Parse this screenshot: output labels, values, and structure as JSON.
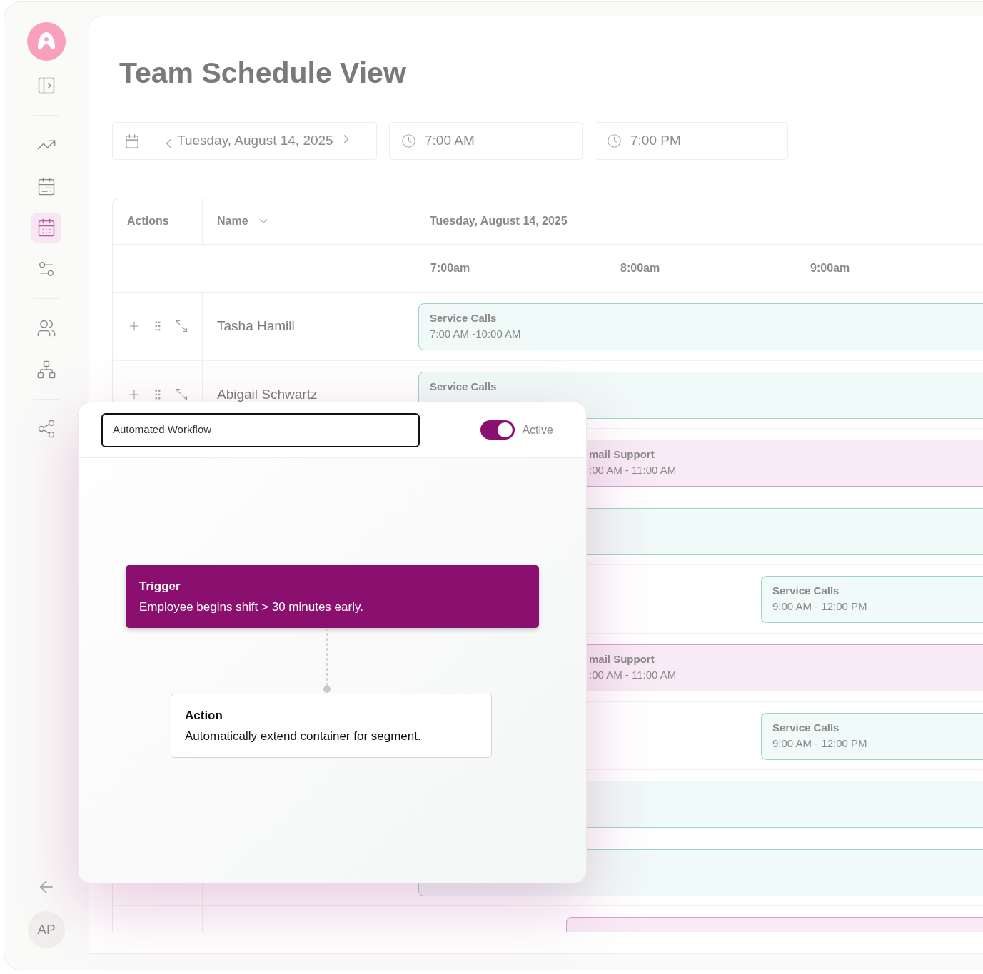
{
  "sidebar": {
    "groups": [
      [
        {
          "kind": "trend",
          "selected": false
        },
        {
          "kind": "calendarlist",
          "selected": false
        },
        {
          "kind": "calendargrid",
          "selected": true
        },
        {
          "kind": "sliders",
          "selected": false
        }
      ],
      [
        {
          "kind": "users",
          "selected": false
        },
        {
          "kind": "network",
          "selected": false
        }
      ],
      [
        {
          "kind": "share",
          "selected": false
        }
      ]
    ],
    "avatar": "AP"
  },
  "page": {
    "title": "Team Schedule View"
  },
  "filters": {
    "date": "Tuesday, August 14, 2025",
    "start_time": "7:00 AM",
    "end_time": "7:00 PM"
  },
  "table": {
    "columns": [
      "Actions",
      "Name"
    ],
    "date_header": "Tuesday, August 14, 2025",
    "time_slots": [
      "7:00am",
      "8:00am",
      "9:00am"
    ],
    "rows": [
      {
        "kind": "open",
        "name": "Tasha Hamill",
        "event": {
          "kind": "service",
          "title": "Service Calls",
          "time": "7:00 AM -10:00 AM"
        }
      },
      {
        "kind": "open",
        "name": "Abigail Schwartz",
        "event": {
          "kind": "service",
          "title": "Service Calls"
        }
      },
      {
        "kind": "covered",
        "event": {
          "kind": "emailcovered",
          "title": "mail Support",
          "time": ":00 AM - 11:00 AM"
        }
      },
      {
        "kind": "covered",
        "event": {
          "kind": "service"
        }
      },
      {
        "kind": "covered",
        "event": {
          "kind": "servicelate",
          "title": "Service Calls",
          "time": "9:00 AM - 12:00 PM"
        }
      },
      {
        "kind": "covered",
        "event": {
          "kind": "emailcovered",
          "title": "mail Support",
          "time": ":00 AM - 11:00 AM"
        }
      },
      {
        "kind": "covered",
        "event": {
          "kind": "servicelate",
          "title": "Service Calls",
          "time": "9:00 AM - 12:00 PM"
        }
      },
      {
        "kind": "covered",
        "event": {
          "kind": "service"
        }
      },
      {
        "kind": "covered",
        "event": {
          "kind": "service"
        }
      },
      {
        "kind": "covered",
        "event": {
          "kind": "emailmid"
        }
      }
    ]
  },
  "workflow": {
    "name": "Automated Workflow",
    "toggle": {
      "label": "Active",
      "on": true
    },
    "trigger": {
      "title": "Trigger",
      "text": "Employee begins shift > 30 minutes early."
    },
    "action": {
      "title": "Action",
      "text": "Automatically extend container for segment."
    }
  }
}
